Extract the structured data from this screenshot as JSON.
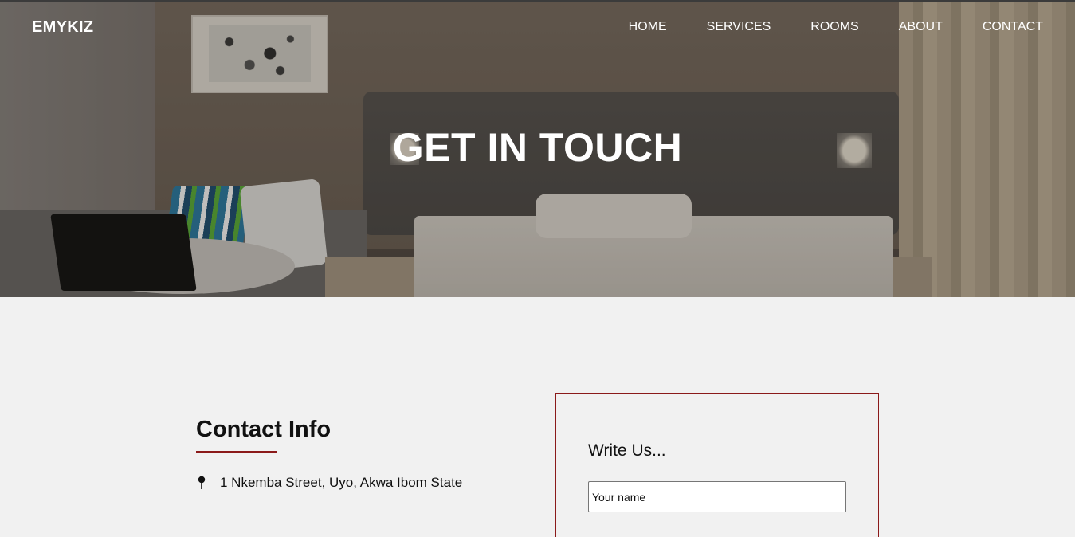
{
  "brand": "EMYKIZ",
  "nav": {
    "items": [
      {
        "label": "HOME"
      },
      {
        "label": "SERVICES"
      },
      {
        "label": "ROOMS"
      },
      {
        "label": "ABOUT"
      },
      {
        "label": "CONTACT"
      }
    ]
  },
  "hero": {
    "title": "GET IN TOUCH"
  },
  "contact_info": {
    "heading": "Contact Info",
    "address": "1 Nkemba Street, Uyo, Akwa Ibom State",
    "address_icon": "map-pin-icon"
  },
  "form": {
    "heading": "Write Us...",
    "name_placeholder": "Your name"
  },
  "colors": {
    "accent": "#8b1a1a",
    "background": "#f1f1f1",
    "nav_text": "#ffffff"
  }
}
